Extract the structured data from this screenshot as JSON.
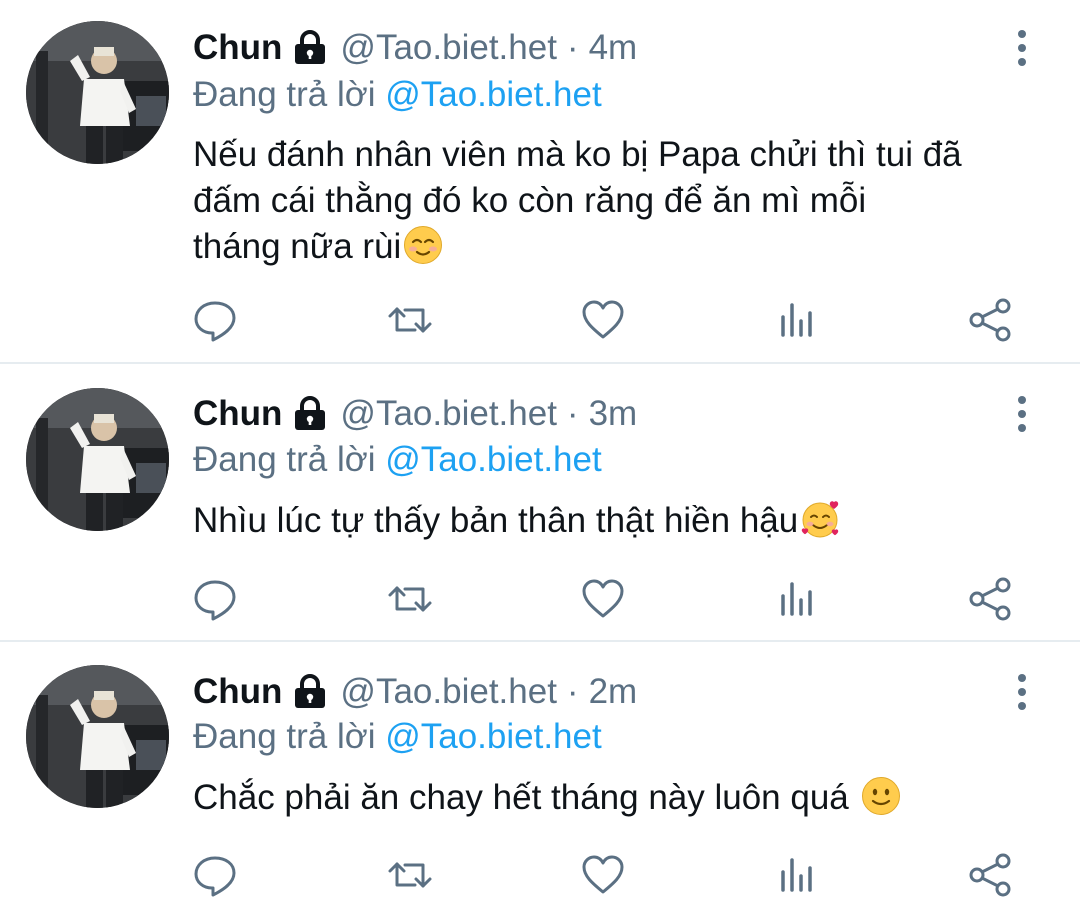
{
  "tweets": [
    {
      "name": "Chun",
      "handle": "@Tao.biet.het",
      "separator": "·",
      "time": "4m",
      "reply_prefix": "Đang trả lời",
      "reply_to": "@Tao.biet.het",
      "text_lines": [
        "Nếu đánh nhân viên mà ko bị Papa chửi thì tui đã",
        "đấm cái thằng đó ko còn răng để ăn mì mỗi",
        "tháng nữa rùi"
      ],
      "emoji": "smiling-face-with-closed-eyes-blush"
    },
    {
      "name": "Chun",
      "handle": "@Tao.biet.het",
      "separator": "·",
      "time": "3m",
      "reply_prefix": "Đang trả lời",
      "reply_to": "@Tao.biet.het",
      "text_lines": [
        "Nhìu lúc tự thấy bản thân thật hiền hậu"
      ],
      "emoji": "smiling-face-with-hearts"
    },
    {
      "name": "Chun",
      "handle": "@Tao.biet.het",
      "separator": "·",
      "time": "2m",
      "reply_prefix": "Đang trả lời",
      "reply_to": "@Tao.biet.het",
      "text_lines": [
        "Chắc phải ăn chay hết tháng này luôn quá "
      ],
      "emoji": "slightly-smiling-face"
    }
  ],
  "icons": {
    "lock": "lock-icon",
    "more": "more-vertical-icon",
    "reply": "reply-icon",
    "retweet": "retweet-icon",
    "like": "like-heart-icon",
    "analytics": "analytics-icon",
    "share": "share-icon"
  },
  "colors": {
    "text": "#0f1419",
    "secondary": "#5b7083",
    "mention": "#1da1f2",
    "icon": "#5b7083",
    "divider": "#e6ecf0"
  }
}
